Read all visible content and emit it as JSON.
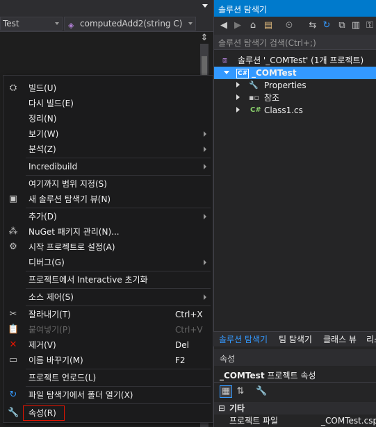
{
  "editor": {
    "nav_left": "Test",
    "nav_right": "computedAdd2(string C)"
  },
  "context_menu": {
    "items": [
      {
        "label": "빌드(U)",
        "icon": "build-icon",
        "shortcut": "",
        "submenu": false
      },
      {
        "label": "다시 빌드(E)",
        "icon": "",
        "shortcut": "",
        "submenu": false
      },
      {
        "label": "정리(N)",
        "icon": "",
        "shortcut": "",
        "submenu": false
      },
      {
        "label": "보기(W)",
        "icon": "",
        "shortcut": "",
        "submenu": true
      },
      {
        "label": "분석(Z)",
        "icon": "",
        "shortcut": "",
        "submenu": true
      },
      {
        "label": "Incredibuild",
        "icon": "",
        "shortcut": "",
        "submenu": true
      },
      {
        "label": "여기까지 범위 지정(S)",
        "icon": "",
        "shortcut": "",
        "submenu": false
      },
      {
        "label": "새 솔루션 탐색기 뷰(N)",
        "icon": "new-view-icon",
        "shortcut": "",
        "submenu": false
      },
      {
        "label": "추가(D)",
        "icon": "",
        "shortcut": "",
        "submenu": true
      },
      {
        "label": "NuGet 패키지 관리(N)...",
        "icon": "nuget-icon",
        "shortcut": "",
        "submenu": false
      },
      {
        "label": "시작 프로젝트로 설정(A)",
        "icon": "gear-icon",
        "shortcut": "",
        "submenu": false
      },
      {
        "label": "디버그(G)",
        "icon": "",
        "shortcut": "",
        "submenu": true
      },
      {
        "label": "프로젝트에서 Interactive 초기화",
        "icon": "",
        "shortcut": "",
        "submenu": false
      },
      {
        "label": "소스 제어(S)",
        "icon": "",
        "shortcut": "",
        "submenu": true
      },
      {
        "label": "잘라내기(T)",
        "icon": "scissors-icon",
        "shortcut": "Ctrl+X",
        "submenu": false
      },
      {
        "label": "붙여넣기(P)",
        "icon": "paste-icon",
        "shortcut": "Ctrl+V",
        "submenu": false
      },
      {
        "label": "제거(V)",
        "icon": "delete-icon",
        "shortcut": "Del",
        "submenu": false
      },
      {
        "label": "이름 바꾸기(M)",
        "icon": "rename-icon",
        "shortcut": "F2",
        "submenu": false
      },
      {
        "label": "프로젝트 언로드(L)",
        "icon": "",
        "shortcut": "",
        "submenu": false
      },
      {
        "label": "파일 탐색기에서 폴더 열기(X)",
        "icon": "refresh-arrow-icon",
        "shortcut": "",
        "submenu": false
      },
      {
        "label": "속성(R)",
        "icon": "wrench-icon",
        "shortcut": "",
        "submenu": false
      }
    ]
  },
  "solution_explorer": {
    "title": "솔루션 탐색기",
    "search_placeholder": "솔루션 탐색기 검색(Ctrl+;)",
    "tree": {
      "solution": "솔루션 '_COMTest' (1개 프로젝트)",
      "project": "_COMTest",
      "properties": "Properties",
      "references": "참조",
      "class_file": "Class1.cs"
    },
    "tabs": [
      "솔루션 탐색기",
      "팀 탐색기",
      "클래스 뷰",
      "리소"
    ]
  },
  "properties_panel": {
    "title": "속성",
    "object_name": "_COMTest",
    "object_suffix": " 프로젝트 속성",
    "category": "기타",
    "row_name": "프로젝트 파일",
    "row_value": "_COMTest.cspro"
  },
  "colors": {
    "accent": "#007acc",
    "selection": "#3399ff",
    "delete_red": "#e51400",
    "csharp_green": "#8bd16c"
  }
}
